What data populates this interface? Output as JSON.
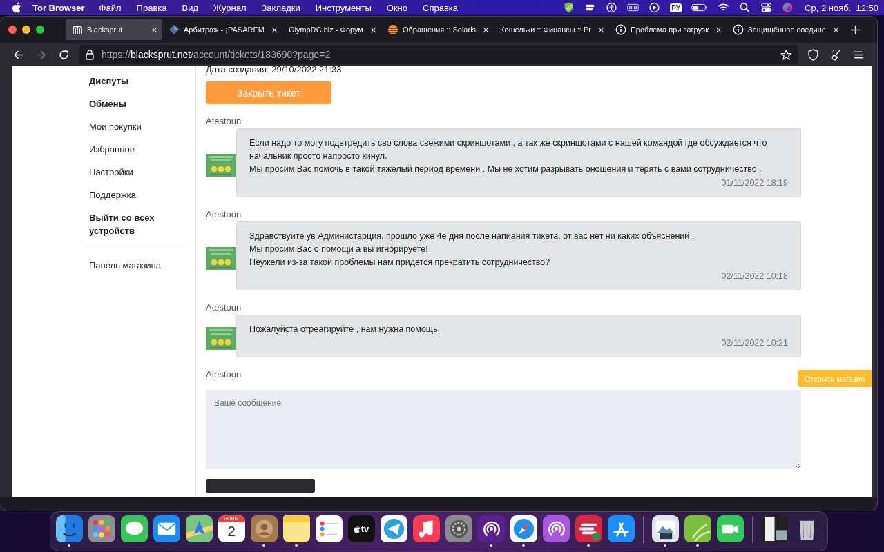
{
  "menubar": {
    "app": "Tor Browser",
    "menus": [
      "Файл",
      "Правка",
      "Вид",
      "Журнал",
      "Закладки",
      "Инструменты",
      "Окно",
      "Справка"
    ],
    "input_source": "РУ",
    "clock": "Ср, 2 нояб.  12:50"
  },
  "tabs": [
    {
      "title": "Blacksprut",
      "selected": true,
      "kind": "logo"
    },
    {
      "title": "Арбитраж - ¡PASAREM",
      "selected": false,
      "kind": "diamond"
    },
    {
      "title": "OlympRC.biz - Форум",
      "selected": false,
      "kind": "plain"
    },
    {
      "title": "Обращения :: Solaris",
      "selected": false,
      "kind": "stripes"
    },
    {
      "title": "Кошельки :: Финансы :: Pr",
      "selected": false,
      "kind": "plain"
    },
    {
      "title": "Проблема при загрузк",
      "selected": false,
      "kind": "info"
    },
    {
      "title": "Защищённое соедине",
      "selected": false,
      "kind": "info"
    }
  ],
  "url": {
    "scheme": "https://",
    "host": "blacksprut.net",
    "path": "/account/tickets/183690?page=2"
  },
  "sidebar": {
    "items": [
      {
        "label": "Диспуты",
        "bold": true
      },
      {
        "label": "Обмены",
        "bold": true
      },
      {
        "label": "Мои покупки",
        "bold": false
      },
      {
        "label": "Избранное",
        "bold": false
      },
      {
        "label": "Настройки",
        "bold": false
      },
      {
        "label": "Поддержка",
        "bold": false
      },
      {
        "label": "Выйти со всех устройств",
        "bold": true
      }
    ],
    "footer_items": [
      {
        "label": "Панель магазина",
        "bold": false
      }
    ]
  },
  "ticket": {
    "created": "Дата создания: 29/10/2022 21:33",
    "close_button": "Закрыть тикет",
    "messages": [
      {
        "author": "Atestoun",
        "paragraphs": [
          "Если надо то могу подвтредить сво слова свежими скриншотами , а так же скриншотами с нашей командой где обсуждается что начальник просто напросто кинул.",
          "Мы просим Вас помочь в такой тяжелый период времени . Мы не хотим разрывать оношения и терять с вами сотрудничество ."
        ],
        "time": "01/11/2022 18:19"
      },
      {
        "author": "Atestoun",
        "paragraphs": [
          "Здравствуйте ув Администарция, прошло уже 4е дня после напиания тикета, от вас нет ни каких объяснений .",
          "Мы просим Вас о помощи а вы игнорируете!",
          "Неужели из-за такой проблемы нам придется прекратить сотрудничество?"
        ],
        "time": "02/11/2022 10:18"
      },
      {
        "author": "Atestoun",
        "paragraphs": [
          "Пожалуйста отреагируйте , нам нужна помощь!"
        ],
        "time": "02/11/2022 10:21"
      }
    ],
    "reply": {
      "author": "Atestoun",
      "placeholder": "Ваше сообщение"
    }
  },
  "floating_button": "Открыть магазин",
  "dock": {
    "items": [
      {
        "kind": "finder",
        "running": true
      },
      {
        "kind": "launchpad",
        "running": false
      },
      {
        "kind": "messages",
        "running": false
      },
      {
        "kind": "mail",
        "running": false
      },
      {
        "kind": "maps",
        "running": false
      },
      {
        "kind": "calendar",
        "running": false,
        "month": "НОЯБ.",
        "day": "2"
      },
      {
        "kind": "contacts",
        "running": true
      },
      {
        "kind": "notes",
        "running": true
      },
      {
        "kind": "reminders",
        "running": false
      },
      {
        "kind": "tv",
        "running": false,
        "label": "tv"
      },
      {
        "kind": "telegram",
        "running": false
      },
      {
        "kind": "music",
        "running": false
      },
      {
        "kind": "settings",
        "running": false
      },
      {
        "kind": "tor",
        "running": true
      },
      {
        "kind": "safari",
        "running": true
      },
      {
        "kind": "podcasts",
        "running": false
      },
      {
        "kind": "vpn",
        "running": true
      },
      {
        "kind": "appstore",
        "running": false
      },
      {
        "kind": "divider"
      },
      {
        "kind": "preview",
        "running": true
      },
      {
        "kind": "shield",
        "running": true
      },
      {
        "kind": "facetime",
        "running": false
      },
      {
        "kind": "divider"
      },
      {
        "kind": "stack",
        "running": false
      },
      {
        "kind": "trash",
        "running": false
      }
    ]
  }
}
